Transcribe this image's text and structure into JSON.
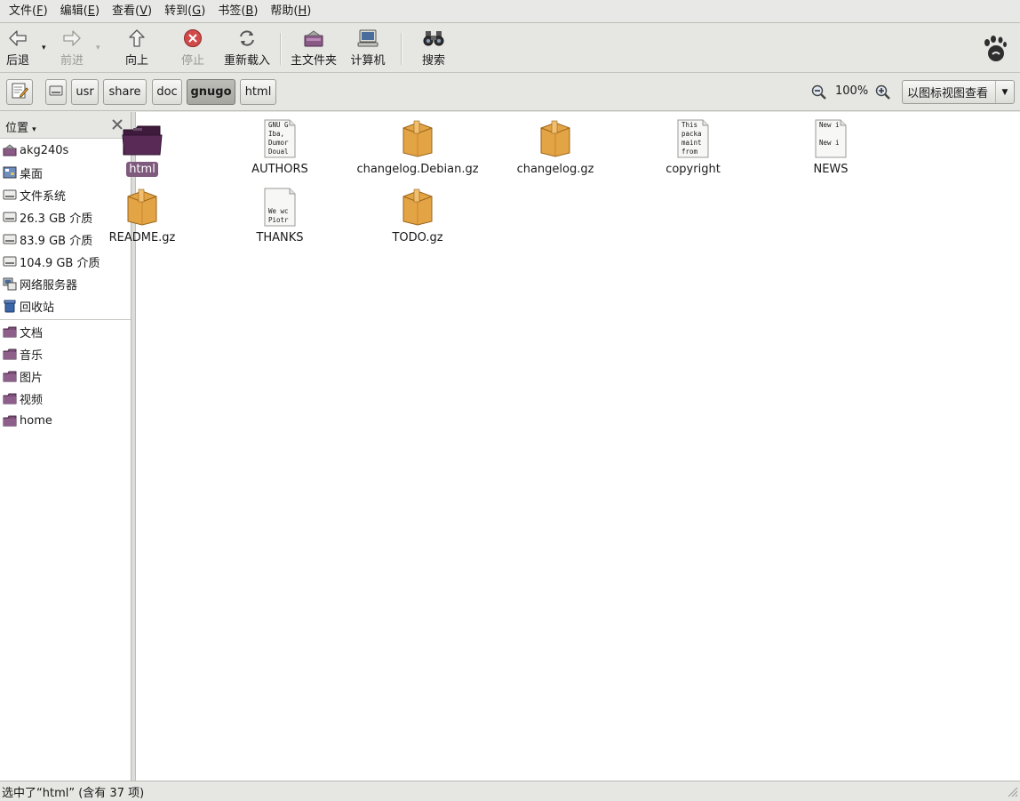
{
  "menubar": {
    "items": [
      {
        "label": "文件(",
        "key": "F",
        "tail": ")"
      },
      {
        "label": "编辑(",
        "key": "E",
        "tail": ")"
      },
      {
        "label": "查看(",
        "key": "V",
        "tail": ")"
      },
      {
        "label": "转到(",
        "key": "G",
        "tail": ")"
      },
      {
        "label": "书签(",
        "key": "B",
        "tail": ")"
      },
      {
        "label": "帮助(",
        "key": "H",
        "tail": ")"
      }
    ]
  },
  "toolbar": {
    "back": "后退",
    "forward": "前进",
    "up": "向上",
    "stop": "停止",
    "reload": "重新载入",
    "home": "主文件夹",
    "computer": "计算机",
    "search": "搜索"
  },
  "location": {
    "path": [
      "usr",
      "share",
      "doc",
      "gnugo",
      "html"
    ],
    "active": "gnugo",
    "zoom": "100%",
    "view_mode": "以图标视图查看"
  },
  "sidebar": {
    "title": "位置",
    "places": [
      {
        "label": "akg240s",
        "icon": "home-folder-icon"
      },
      {
        "label": "桌面",
        "icon": "desktop-icon"
      },
      {
        "label": "文件系统",
        "icon": "drive-icon"
      },
      {
        "label": "26.3 GB 介质",
        "icon": "drive-icon"
      },
      {
        "label": "83.9 GB 介质",
        "icon": "drive-icon"
      },
      {
        "label": "104.9 GB 介质",
        "icon": "drive-icon"
      },
      {
        "label": "网络服务器",
        "icon": "network-icon"
      },
      {
        "label": "回收站",
        "icon": "trash-icon"
      }
    ],
    "bookmarks": [
      {
        "label": "文档",
        "icon": "folder-icon"
      },
      {
        "label": "音乐",
        "icon": "folder-icon"
      },
      {
        "label": "图片",
        "icon": "folder-icon"
      },
      {
        "label": "视频",
        "icon": "folder-icon"
      },
      {
        "label": "home",
        "icon": "folder-icon"
      }
    ]
  },
  "files": [
    {
      "name": "html",
      "type": "folder",
      "selected": true
    },
    {
      "name": "AUTHORS",
      "type": "text",
      "preview": [
        "GNU G",
        "Iba,",
        "Dumor",
        "Doual"
      ]
    },
    {
      "name": "changelog.Debian.gz",
      "type": "archive"
    },
    {
      "name": "changelog.gz",
      "type": "archive"
    },
    {
      "name": "copyright",
      "type": "text",
      "preview": [
        "This",
        "packa",
        "maint",
        "from"
      ]
    },
    {
      "name": "NEWS",
      "type": "text",
      "preview": [
        "New i",
        "",
        "New i",
        ""
      ]
    },
    {
      "name": "README.gz",
      "type": "archive"
    },
    {
      "name": "THANKS",
      "type": "text",
      "preview": [
        "",
        "",
        "We wc",
        "Piotr"
      ]
    },
    {
      "name": "TODO.gz",
      "type": "archive"
    }
  ],
  "status": "选中了“html” (含有 37 项)",
  "colors": {
    "selection": "#7f5a7d",
    "folder_purple": "#5a2a57",
    "archive_orange": "#e0a040",
    "stop_red": "#cc3b3b"
  }
}
